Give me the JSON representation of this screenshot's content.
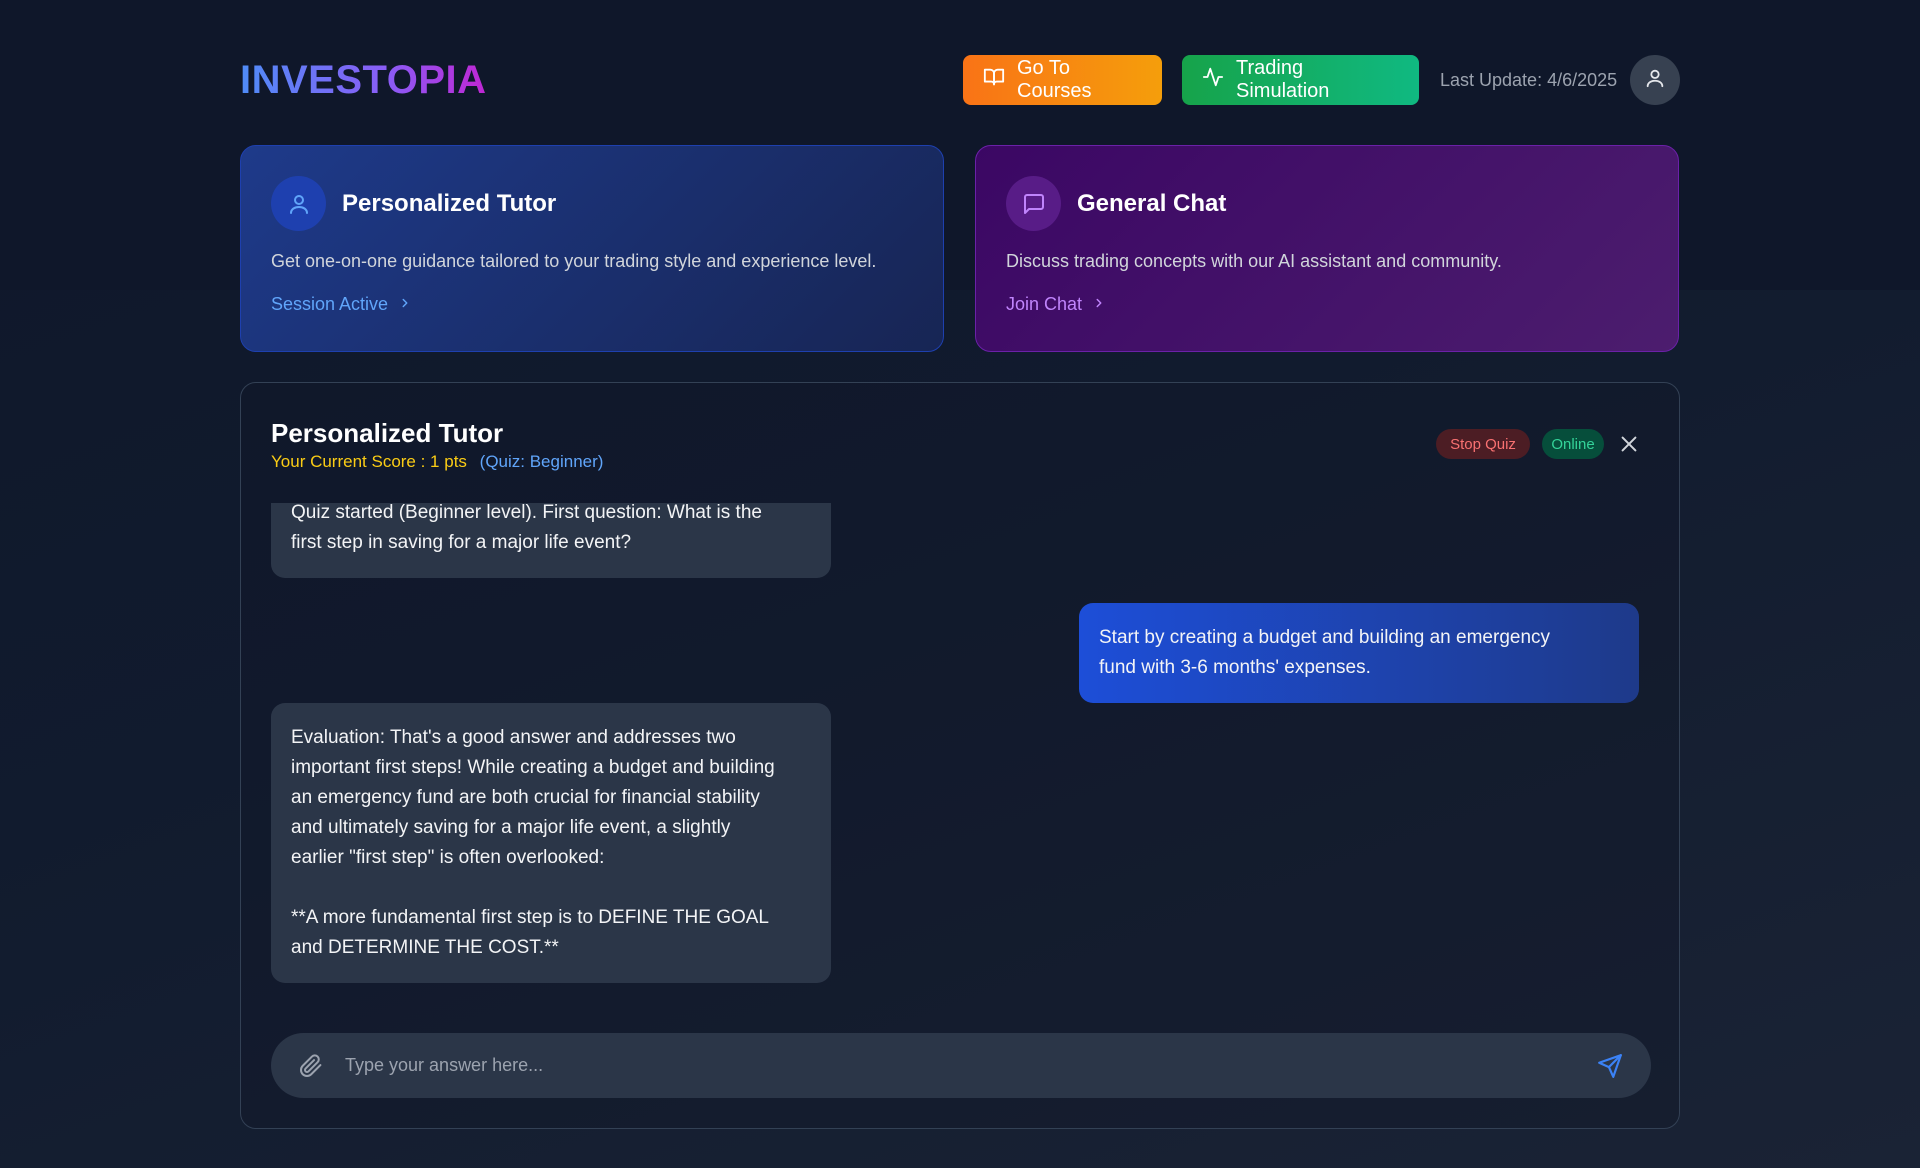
{
  "app": {
    "logo": "INVESTOPIA"
  },
  "header": {
    "courses_label": "Go To Courses",
    "simulation_label": "Trading Simulation",
    "last_update": "Last Update: 4/6/2025"
  },
  "cards": {
    "tutor": {
      "title": "Personalized Tutor",
      "description": "Get one-on-one guidance tailored to your trading style and experience level.",
      "link": "Session Active"
    },
    "chat": {
      "title": "General Chat",
      "description": "Discuss trading concepts with our AI assistant and community.",
      "link": "Join Chat"
    }
  },
  "panel": {
    "title": "Personalized Tutor",
    "score": "Your Current Score : 1 pts",
    "quiz_level": "(Quiz: Beginner)",
    "stop_label": "Stop Quiz",
    "status": "Online"
  },
  "messages": [
    {
      "role": "ai",
      "lines": [
        "Quiz started (Beginner level). First question: What is the",
        "first step in saving for a major life event?"
      ]
    },
    {
      "role": "user",
      "lines": [
        "Start by creating a budget and building an emergency",
        "fund with 3-6 months' expenses."
      ]
    },
    {
      "role": "ai",
      "lines": [
        "Evaluation: That's a good answer and addresses two",
        "important first steps! While creating a budget and building",
        "an emergency fund are both crucial for financial stability",
        "and ultimately saving for a major life event, a slightly",
        "earlier \"first step\" is often overlooked:",
        "",
        "**A more fundamental first step is to DEFINE THE GOAL",
        "and DETERMINE THE COST.**"
      ]
    }
  ],
  "composer": {
    "placeholder": "Type your answer here..."
  },
  "colors": {
    "accent_blue": "#60a5fa",
    "score_yellow": "#facc15",
    "online_green": "#34d399",
    "stop_red": "#f87171"
  }
}
